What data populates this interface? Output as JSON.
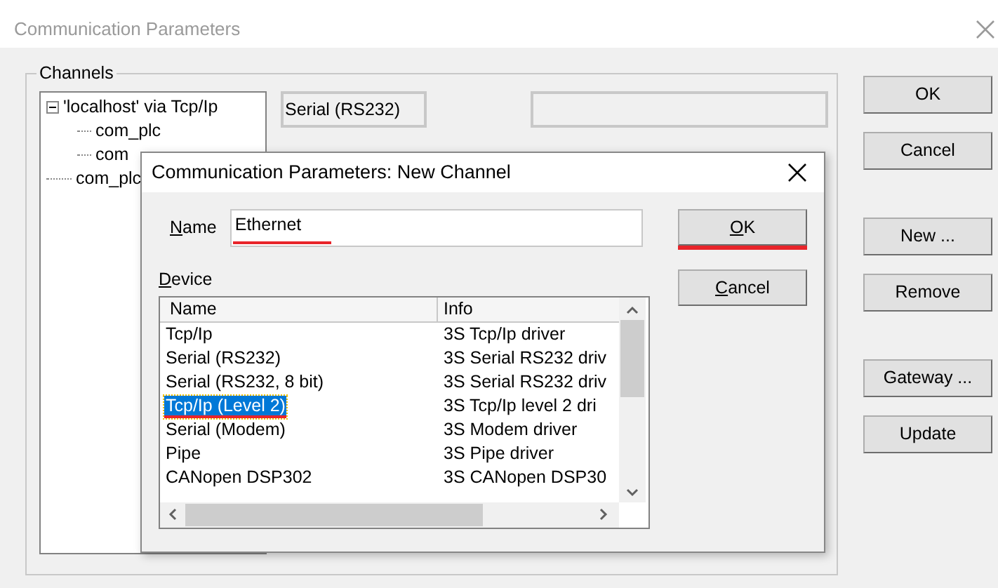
{
  "main_window": {
    "title": "Communication Parameters",
    "channels": {
      "label": "Channels",
      "tree": [
        {
          "label": "'localhost' via Tcp/Ip",
          "expanded": true,
          "children": [
            {
              "label": "com_plc"
            },
            {
              "label": "com"
            }
          ]
        },
        {
          "label": "com_plc"
        }
      ]
    },
    "device_field": {
      "value": "Serial (RS232)"
    },
    "button_groups": [
      [
        "OK",
        "Cancel"
      ],
      [
        "New ...",
        "Remove"
      ],
      [
        "Gateway ...",
        "Update"
      ]
    ]
  },
  "dialog": {
    "title": "Communication Parameters: New Channel",
    "name_label": "Name",
    "name_field": {
      "value": "Ethernet",
      "underlined": true
    },
    "ok_button": {
      "label": "OK",
      "underlined": true
    },
    "cancel_button": {
      "label": "Cancel",
      "underlined": false
    },
    "device_label": "Device",
    "columns": [
      "Name",
      "Info"
    ],
    "rows": [
      {
        "name": "Tcp/Ip",
        "info": "3S Tcp/Ip driver",
        "selected": false,
        "underlined": false
      },
      {
        "name": "Serial (RS232)",
        "info": "3S Serial RS232 driv",
        "selected": false,
        "underlined": false
      },
      {
        "name": "Serial (RS232, 8 bit)",
        "info": "3S Serial RS232 driv",
        "selected": false,
        "underlined": false
      },
      {
        "name": "Tcp/Ip (Level 2)",
        "info": "3S Tcp/Ip level 2 dri",
        "selected": true,
        "underlined": true
      },
      {
        "name": "Serial (Modem)",
        "info": "3S Modem driver",
        "selected": false,
        "underlined": false
      },
      {
        "name": "Pipe",
        "info": "3S Pipe driver",
        "selected": false,
        "underlined": false
      },
      {
        "name": "CANopen DSP302",
        "info": "3S CANopen DSP30",
        "selected": false,
        "underlined": false
      }
    ]
  }
}
